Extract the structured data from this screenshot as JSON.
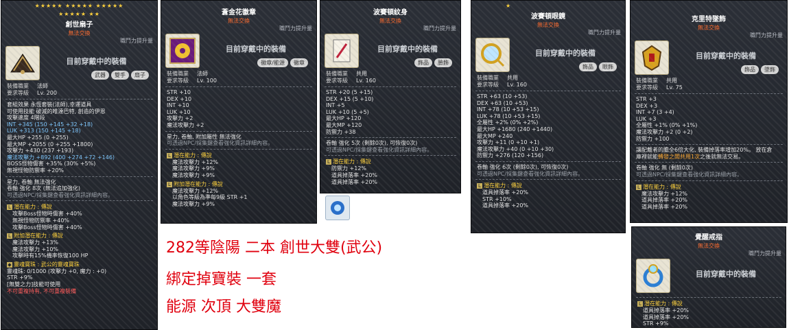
{
  "panel1": {
    "stars1": "★★★★★ ★★★★★ ★★★★★",
    "stars2": "★★★★★ ★★",
    "title": "創世扇子",
    "subtitle": "無法交換",
    "powerup": "職鬥力提升量",
    "equipped": "目前穿戴中的裝備",
    "tags": [
      "武器",
      "雙手",
      "扇子"
    ],
    "req_job_k": "裝備職業",
    "req_job_v": "法師",
    "req_lv_k": "要求等級",
    "req_lv_v": "Lv. 200",
    "set_lines": [
      "套組效果  永恆套裝(法師),幸運道具",
      "可使用技能   破滅的唯達巴特, 創造的伊恩",
      "攻擊速度       4階段"
    ],
    "stats": [
      "INT  +345 (150 +145 +32 +18)",
      "LUK  +313 (150 +145 +18)",
      "最大HP  +255 (0 +255)",
      "最大MP  +2055 (0 +255 +1800)",
      "攻擊力  +430 (237 +193)",
      "魔法攻擊力  +892 (400 +274 +72 +146)",
      "BOSS怪物傷害  +35% (30% +5%)",
      "無視怪物防禦率  +20%"
    ],
    "misc": [
      "星力, 卷軸  無法強化",
      "卷軸 強化 8次 (無法追加強化)",
      "可透過NPC/採集鍵查看強化資訊詳細內容。"
    ],
    "pot_head": "潛在能力 : 傳說",
    "pot": [
      "攻擊Boss怪物時傷害 +40%",
      "無視怪物防禦率 +40%",
      "攻擊Boss怪物時傷害 +40%"
    ],
    "add_head": "附加潛在能力 : 傳說",
    "add": [
      "魔法攻擊力 +13%",
      "魔法攻擊力 +10%",
      "攻擊時有15%機率恢復100 HP"
    ],
    "soul_head": "靈魂寶珠 : 武公的靈魂寶珠",
    "soul": [
      "靈魂珠: 0/1000 (攻擊力 +0, 魔力 : +0)",
      "STR +9%",
      "[無雙之力]技能可使用"
    ],
    "warn": "不可重複持有, 不可重複裝備"
  },
  "panel2": {
    "title": "蒼金花徽章",
    "subtitle": "無法交換",
    "powerup": "職鬥力提升量",
    "equipped": "目前穿戴中的裝備",
    "tags": [
      "徽章/能源",
      "徽章"
    ],
    "req_job_k": "裝備職業",
    "req_job_v": "法師",
    "req_lv_k": "要求等級",
    "req_lv_v": "Lv. 100",
    "stats": [
      "STR  +10",
      "DEX  +10",
      "INT  +10",
      "LUK  +10",
      "攻擊力  +2",
      "魔法攻擊力  +2"
    ],
    "misc": [
      "星力, 卷軸, 附加屬性 無法強化",
      "可透過NPC/採集鍵查看強化資訊詳細內容。"
    ],
    "pot_head": "潛在能力 : 傳說",
    "pot": [
      "魔法攻擊力 +12%",
      "魔法攻擊力 +9%",
      "魔法攻擊力 +9%"
    ],
    "add_head": "附加潛在能力 : 傳說",
    "add": [
      "魔法攻擊力 +12%",
      "以角色等級為準每9級 STR +1",
      "魔法攻擊力 +9%"
    ]
  },
  "panel3": {
    "title": "波賽頓紋身",
    "subtitle": "無法交換",
    "powerup": "職鬥力提升量",
    "equipped": "目前穿戴中的裝備",
    "tags": [
      "飾品",
      "臉飾"
    ],
    "req_job_k": "裝備職業",
    "req_job_v": "共用",
    "req_lv_k": "要求等級",
    "req_lv_v": "Lv. 160",
    "stats": [
      "STR  +20 (5 +15)",
      "DEX  +15 (5 +10)",
      "INT  +5",
      "LUK  +10 (5 +5)",
      "最大HP  +120",
      "最大MP  +120",
      "防禦力  +38"
    ],
    "misc": [
      "卷軸 強化 5次 (剩餘0次), 可恢復0次)",
      "可透過NPC/採集鍵查看強化資訊詳細內容。"
    ],
    "pot_head": "潛在能力 : 傳說",
    "pot": [
      "防禦力 +12%",
      "道具掉落率 +20%",
      "道具掉落率 +20%"
    ]
  },
  "panel4": {
    "stars": "★",
    "title": "波賽頓眼鏡",
    "subtitle": "無法交換",
    "powerup": "職鬥力提升量",
    "equipped": "目前穿戴中的裝備",
    "tags": [
      "飾品",
      "眼飾"
    ],
    "req_job_k": "裝備職業",
    "req_job_v": "共用",
    "req_lv_k": "要求等級",
    "req_lv_v": "Lv. 160",
    "stats": [
      "STR  +63 (10 +53)",
      "DEX  +63 (10 +53)",
      "INT  +78 (10 +53 +15)",
      "LUK  +78 (10 +53 +15)",
      "全屬性  +2% (0% +2%)",
      "最大HP  +1680 (240 +1440)",
      "最大MP  +240",
      "攻擊力  +11 (0 +10 +1)",
      "魔法攻擊力  +40 (0 +10 +30)",
      "防禦力  +276 (120 +156)"
    ],
    "misc": [
      "卷軸 強化 6次 (剩餘0次), 可恢復0次)",
      "可透過NPC/採集鍵查看強化資訊詳細內容。"
    ],
    "pot_head": "潛在能力 : 傳說",
    "pot": [
      "道具掉落率 +20%",
      "STR +10%",
      "道具掉落率 +20%"
    ]
  },
  "panel5": {
    "title": "克里特墜飾",
    "subtitle": "無法交換",
    "powerup": "職鬥力提升量",
    "equipped": "目前穿戴中的裝備",
    "tags": [
      "飾品",
      "墜飾"
    ],
    "req_job_k": "裝備職業",
    "req_job_v": "共用",
    "req_lv_k": "要求等級",
    "req_lv_v": "Lv. 75",
    "stats": [
      "STR  +3",
      "DEX  +3",
      "INT  +7 (3 +4)",
      "LUK  +3",
      "全屬性  +1% (0% +1%)",
      "魔法攻擊力  +2 (0 +2)",
      "防禦力  +100"
    ],
    "desc": [
      "讓配戴者的膽全6倍大化, 裝備掉落率增加20%。 放在倉",
      "庫裡就能",
      "之後就無法交易。"
    ],
    "desc_hl": "轉發之闆共用1次",
    "misc": [
      "卷軸 強化 無 (剩餘0次)",
      "可透過NPC/採集鍵查看強化資訊詳細內容。"
    ],
    "pot_head": "潛在能力 : 傳說",
    "pot": [
      "魔法攻擊力 +12%",
      "道具掉落率 +20%",
      "道具掉落率 +20%"
    ]
  },
  "panel6": {
    "title": "覺醒戒指",
    "subtitle": "無法交換",
    "powerup": "職鬥力提升量",
    "equipped": "目前穿戴中的裝備",
    "pot_head": "潛在能力 : 傳說",
    "pot": [
      "道具掉落率 +20%",
      "道具掉落率 +20%",
      "STR +9%"
    ]
  },
  "notes": [
    "282等陰陽 二本  創世大雙(武公)",
    "綁定掉寶裝 一套",
    "能源 次頂 大雙魔"
  ]
}
